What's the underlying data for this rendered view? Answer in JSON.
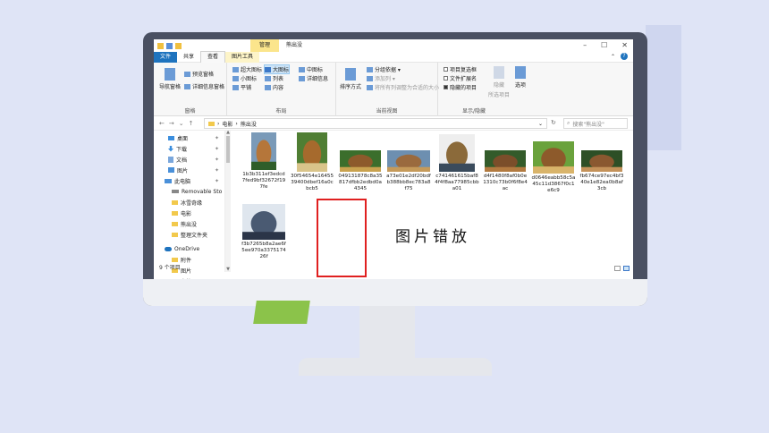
{
  "window": {
    "manage_tab": "管理",
    "title": "熊出没",
    "minimize": "–",
    "maximize": "☐",
    "close": "✕"
  },
  "menu": {
    "file": "文件",
    "home": "主页",
    "share": "共享",
    "view": "查看",
    "picture_tools": "图片工具",
    "collapse": "⌃",
    "help": "?"
  },
  "ribbon": {
    "panes": {
      "nav_pane": "导航窗格",
      "preview_pane": "预览窗格",
      "details_pane": "详细信息窗格",
      "label": "窗格"
    },
    "layout": {
      "xlarge": "超大图标",
      "large": "大图标",
      "medium": "中图标",
      "small": "小图标",
      "list": "列表",
      "details": "详细信息",
      "tiles": "平铺",
      "content": "内容",
      "label": "布局"
    },
    "current_view": {
      "sort": "排序方式",
      "group": "分组依据 ▾",
      "add_column": "添加列 ▾",
      "fit_columns": "将所有列调整为合适的大小",
      "label": "当前视图"
    },
    "show_hide": {
      "item_checkbox": "项目复选框",
      "extensions": "文件扩展名",
      "hidden_items": "隐藏的项目",
      "hide_selected_1": "隐藏",
      "hide_selected_2": "所选项目",
      "options": "选项",
      "label": "显示/隐藏"
    }
  },
  "address": {
    "back": "←",
    "forward": "→",
    "recent": "⌄",
    "up": "↑",
    "path_sep": "›",
    "path_1": "电影",
    "path_2": "熊出没",
    "dropdown": "⌄",
    "refresh": "↻",
    "search_placeholder": "搜索\"熊出没\""
  },
  "nav_items": [
    {
      "label": "桌面",
      "pin": "✦"
    },
    {
      "label": "下载",
      "pin": "✦"
    },
    {
      "label": "文档",
      "pin": "✦"
    },
    {
      "label": "图片",
      "pin": "✦"
    },
    {
      "label": "此电脑",
      "pin": "✦"
    },
    {
      "label": "Removable Sto",
      "pin": ""
    },
    {
      "label": "冰雪奇缘",
      "pin": ""
    },
    {
      "label": "电影",
      "pin": ""
    },
    {
      "label": "熊出没",
      "pin": ""
    },
    {
      "label": "整理文件夹",
      "pin": ""
    },
    {
      "label": "OneDrive",
      "pin": ""
    },
    {
      "label": "附件",
      "pin": ""
    },
    {
      "label": "图片",
      "pin": ""
    },
    {
      "label": "文档",
      "pin": ""
    },
    {
      "label": "此电脑",
      "pin": ""
    }
  ],
  "files": [
    {
      "name": "1b3b311ef3edcd7fed9bf32672f197fe",
      "colors": [
        "#7a9ab8",
        "#b5763a",
        "#2f5e2a"
      ]
    },
    {
      "name": "30f54654e1645539400dbef16a0cbcb5",
      "colors": [
        "#4f7e33",
        "#a66a2d",
        "#d9c48a"
      ]
    },
    {
      "name": "049131878c8a35817dfbb2edbd0a4345",
      "colors": [
        "#3b6e2c",
        "#8d5a2b",
        "#c9a24f"
      ]
    },
    {
      "name": "a73e01e2df20bdfb388bb8ec783a8f75",
      "colors": [
        "#6d8fb0",
        "#9a6a3e",
        "#c59a5a"
      ]
    },
    {
      "name": "c741461615baf84f4f8aa77985cbba01",
      "colors": [
        "#eeeeee",
        "#8b6a3a",
        "#3a4b5c"
      ]
    },
    {
      "name": "d4f1480f8af0b0e1310c73b0f6f8e4ac",
      "colors": [
        "#335b2a",
        "#7b4e2a",
        "#b27a40"
      ]
    },
    {
      "name": "d0646eabb58c5a45c11d3867f0c1e6c9",
      "colors": [
        "#6aa23c",
        "#8d5a2b",
        "#d9b46a"
      ]
    },
    {
      "name": "fb674ce97ec4bf340e1e82ea0b8af3cb",
      "colors": [
        "#2d4f26",
        "#8a5830",
        "#c4925a"
      ]
    },
    {
      "name": "f3b7265b8a2ae6f5ee970a337517426f",
      "colors": [
        "#dfe6ee",
        "#4a5a72",
        "#2b3548"
      ]
    }
  ],
  "annotation": "图片错放",
  "status": {
    "count": "9 个项目"
  },
  "colors": {
    "accent": "#1e73be",
    "highlight_border": "#e02020",
    "manage_tab": "#fbe58c",
    "background": "#dfe4f6"
  }
}
